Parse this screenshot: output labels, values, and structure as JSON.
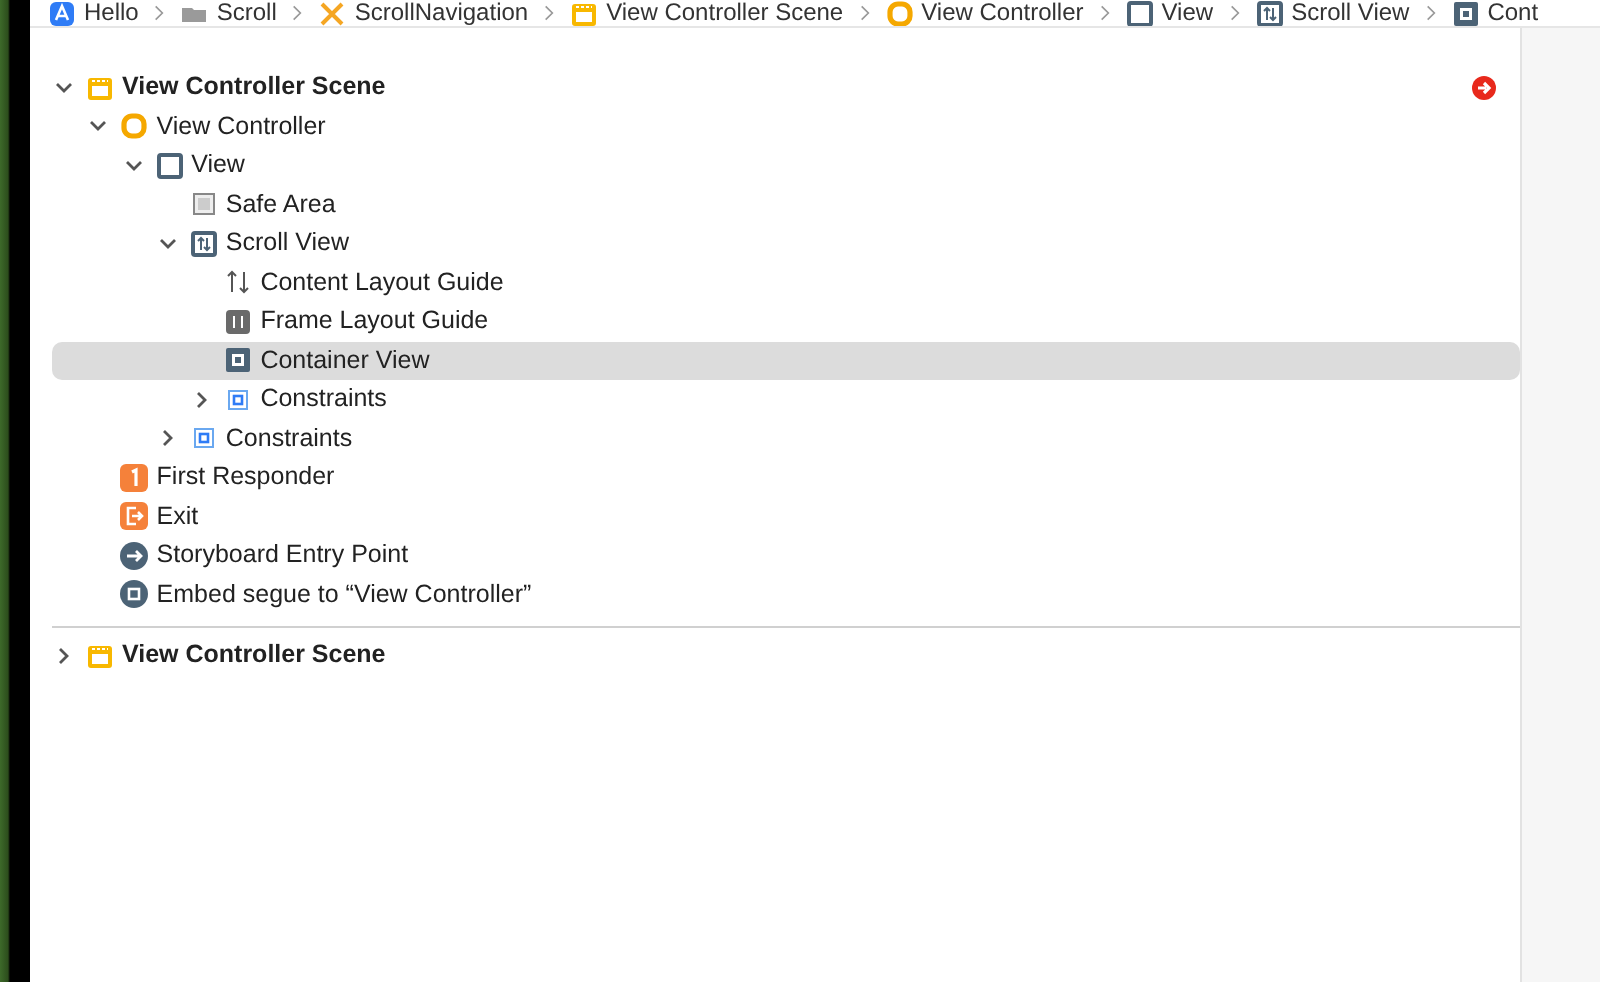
{
  "breadcrumbs": [
    {
      "label": "Hello",
      "kind": "app"
    },
    {
      "label": "Scroll",
      "kind": "folder"
    },
    {
      "label": "ScrollNavigation",
      "kind": "tools"
    },
    {
      "label": "View Controller Scene",
      "kind": "scene"
    },
    {
      "label": "View Controller",
      "kind": "controller"
    },
    {
      "label": "View",
      "kind": "view"
    },
    {
      "label": "Scroll View",
      "kind": "scroll-view"
    },
    {
      "label": "Cont",
      "kind": "container"
    }
  ],
  "outline": [
    {
      "label": "View Controller Scene",
      "kind": "scene",
      "expanded": true,
      "selected": false,
      "entry_arrow": true,
      "children": [
        {
          "label": "View Controller",
          "kind": "controller",
          "expanded": true,
          "selected": false,
          "children": [
            {
              "label": "View",
              "kind": "view",
              "expanded": true,
              "selected": false,
              "children": [
                {
                  "label": "Safe Area",
                  "kind": "safe-area",
                  "selected": false
                },
                {
                  "label": "Scroll View",
                  "kind": "scroll-view",
                  "expanded": true,
                  "selected": false,
                  "children": [
                    {
                      "label": "Content Layout Guide",
                      "kind": "content-guide",
                      "selected": false
                    },
                    {
                      "label": "Frame Layout Guide",
                      "kind": "frame-guide",
                      "selected": false
                    },
                    {
                      "label": "Container View",
                      "kind": "container",
                      "selected": true
                    },
                    {
                      "label": "Constraints",
                      "kind": "constraints",
                      "expanded": false,
                      "selected": false
                    }
                  ]
                },
                {
                  "label": "Constraints",
                  "kind": "constraints",
                  "expanded": false,
                  "selected": false
                }
              ]
            }
          ]
        },
        {
          "label": "First Responder",
          "kind": "responder",
          "selected": false
        },
        {
          "label": "Exit",
          "kind": "exit",
          "selected": false
        },
        {
          "label": "Storyboard Entry Point",
          "kind": "entry",
          "selected": false
        },
        {
          "label": "Embed segue to “View Controller”",
          "kind": "segue",
          "selected": false
        }
      ]
    },
    {
      "label": "View Controller Scene",
      "kind": "scene",
      "expanded": false,
      "selected": false,
      "entry_arrow": false
    }
  ]
}
